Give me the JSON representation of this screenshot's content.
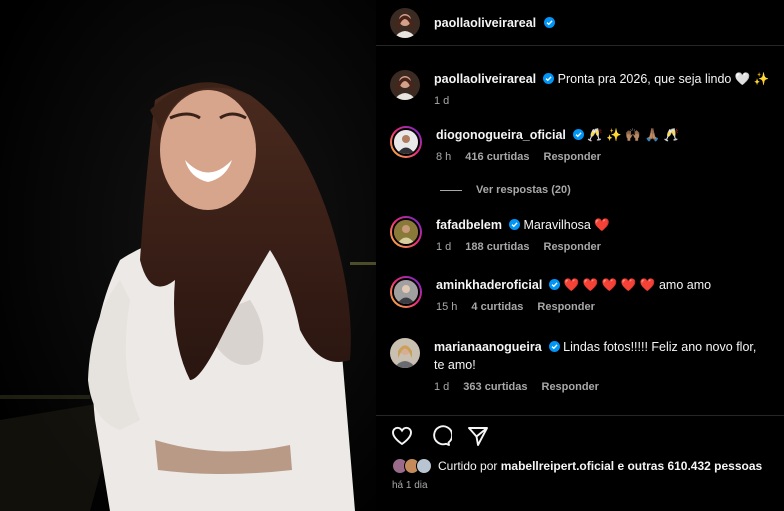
{
  "post": {
    "username": "paollaoliveirareal",
    "caption": "Pronta pra 2026, que seja lindo 🤍 ✨",
    "caption_age": "1 d"
  },
  "comments": [
    {
      "username": "diogonogueira_oficial",
      "verified": true,
      "text": "🥂 ✨ 🙌🏽 🙏🏽 🥂",
      "age": "8 h",
      "likes": "416 curtidas",
      "reply": "Responder",
      "ring": true
    },
    {
      "username": "fafadbelem",
      "verified": true,
      "text": "Maravilhosa ❤️",
      "age": "1 d",
      "likes": "188 curtidas",
      "reply": "Responder",
      "ring": true
    },
    {
      "username": "aminkhaderoficial",
      "verified": true,
      "text": "❤️ ❤️ ❤️ ❤️ ❤️ amo amo",
      "age": "15 h",
      "likes": "4 curtidas",
      "reply": "Responder",
      "ring": true
    },
    {
      "username": "marianaanogueira",
      "verified": true,
      "text": "Lindas fotos!!!!! Feliz ano novo flor, te amo!",
      "age": "1 d",
      "likes": "363 curtidas",
      "reply": "Responder",
      "ring": false
    }
  ],
  "view_replies": "Ver respostas (20)",
  "liked_by": {
    "prefix": "Curtido por",
    "user": "mabellreipert.oficial",
    "suffix": "e outras 610.432 pessoas"
  },
  "post_age": "há 1 dia",
  "colors": {
    "accent_verified": "#0095f6",
    "heart": "#ed2c3c",
    "muted": "#a8a8a8"
  },
  "icons": [
    "heart-icon",
    "comment-icon",
    "share-icon"
  ]
}
